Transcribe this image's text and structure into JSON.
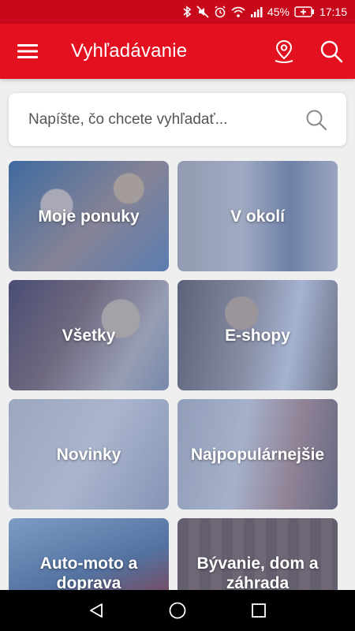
{
  "status_bar": {
    "battery_percent": "45%",
    "time": "17:15",
    "icons": [
      "bluetooth-icon",
      "mute-icon",
      "alarm-icon",
      "wifi-icon",
      "signal-icon",
      "battery-charging-icon"
    ]
  },
  "app_bar": {
    "title": "Vyhľadávanie",
    "icons": [
      "hamburger-menu-icon",
      "location-pin-icon",
      "search-icon"
    ]
  },
  "search": {
    "placeholder": "Napíšte, čo chcete vyhľadať..."
  },
  "categories": [
    {
      "label": "Moje ponuky"
    },
    {
      "label": "V okolí"
    },
    {
      "label": "Všetky"
    },
    {
      "label": "E-shopy"
    },
    {
      "label": "Novinky"
    },
    {
      "label": "Najpopulárnejšie"
    },
    {
      "label": "Auto-moto a doprava"
    },
    {
      "label": "Bývanie, dom a záhrada"
    }
  ],
  "nav_bar": {
    "icons": [
      "back-icon",
      "home-icon",
      "recents-icon"
    ]
  },
  "colors": {
    "primary": "#e3101f",
    "status_bar": "#c8081b",
    "tile_overlay": "#4664aa"
  }
}
